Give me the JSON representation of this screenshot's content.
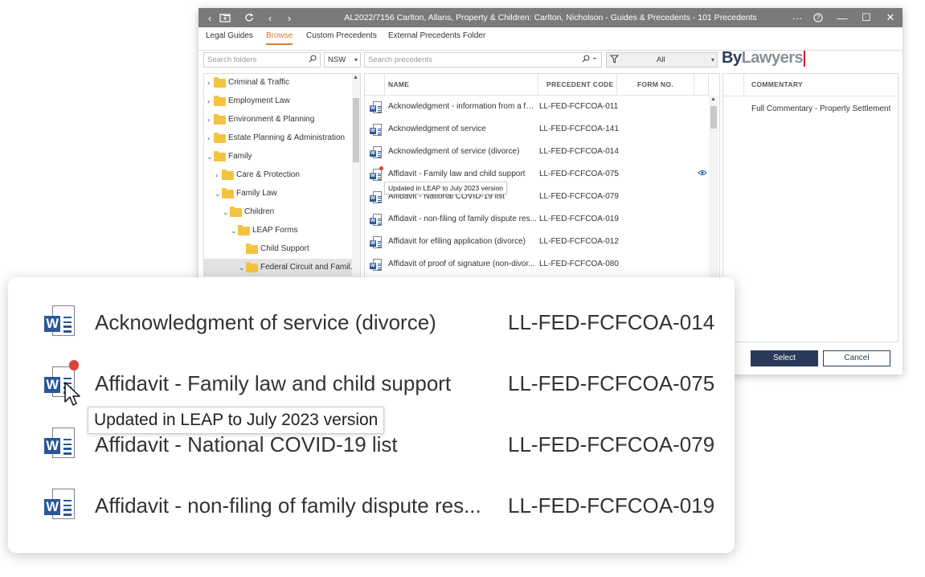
{
  "window": {
    "title": "AL2022/7156 Carlton, Allans, Property & Children: Carlton, Nicholson - Guides & Precedents - 101 Precedents",
    "buttons": {
      "more": "···",
      "help": "?",
      "minimize": "—",
      "maximize": "☐",
      "close": "✕"
    }
  },
  "tabs": [
    {
      "label": "Legal Guides",
      "active": false
    },
    {
      "label": "Browse",
      "active": true
    },
    {
      "label": "Custom Precedents",
      "active": false
    },
    {
      "label": "External Precedents Folder",
      "active": false
    }
  ],
  "search": {
    "folders_placeholder": "Search folders",
    "state_value": "NSW",
    "precedents_placeholder": "Search precedents",
    "filter_value": "All"
  },
  "brand": {
    "part1": "By",
    "part2": "Lawyers"
  },
  "tree": {
    "items": [
      {
        "label": "Criminal & Traffic",
        "chevron": "›"
      },
      {
        "label": "Employment Law",
        "chevron": "›"
      },
      {
        "label": "Environment & Planning",
        "chevron": "›"
      },
      {
        "label": "Estate Planning & Administration",
        "chevron": "›"
      },
      {
        "label": "Family",
        "chevron": "⌄"
      },
      {
        "label": "Care & Protection",
        "chevron": "›"
      },
      {
        "label": "Family Law",
        "chevron": "⌄"
      },
      {
        "label": "Children",
        "chevron": "⌄"
      },
      {
        "label": "LEAP Forms",
        "chevron": "⌄"
      },
      {
        "label": "Child Support",
        "chevron": ""
      },
      {
        "label": "Federal Circuit and Famil...",
        "chevron": "⌄"
      }
    ]
  },
  "grid": {
    "headers": {
      "name": "NAME",
      "code": "PRECEDENT CODE",
      "form": "FORM NO."
    },
    "rows": [
      {
        "name": "Acknowledgment - information from a fa...",
        "code": "LL-FED-FCFCOA-011"
      },
      {
        "name": "Acknowledgment of service",
        "code": "LL-FED-FCFCOA-141"
      },
      {
        "name": "Acknowledgment of service (divorce)",
        "code": "LL-FED-FCFCOA-014"
      },
      {
        "name": "Affidavit - Family law and child support",
        "code": "LL-FED-FCFCOA-075"
      },
      {
        "name": "Affidavit - National COVID-19 list",
        "code": "LL-FED-FCFCOA-079"
      },
      {
        "name": "Affidavit - non-filing of family dispute res...",
        "code": "LL-FED-FCFCOA-019"
      },
      {
        "name": "Affidavit for efiling application (divorce)",
        "code": "LL-FED-FCFCOA-012"
      },
      {
        "name": "Affidavit of proof of signature (non-divor...",
        "code": "LL-FED-FCFCOA-080"
      }
    ],
    "tooltip": "Updated in LEAP to July 2023 version"
  },
  "commentary": {
    "header": "COMMENTARY",
    "item": "Full Commentary - Property Settlement"
  },
  "actions": {
    "select": "Select",
    "cancel": "Cancel"
  },
  "icons": {
    "word": "W"
  },
  "zoom": {
    "rows": [
      {
        "name": "Acknowledgment of service (divorce)",
        "code": "LL-FED-FCFCOA-014"
      },
      {
        "name": "Affidavit - Family law and child support",
        "code": "LL-FED-FCFCOA-075"
      },
      {
        "name": "Affidavit - National COVID-19 list",
        "code": "LL-FED-FCFCOA-079"
      },
      {
        "name": "Affidavit - non-filing of family dispute res...",
        "code": "LL-FED-FCFCOA-019"
      }
    ],
    "tooltip": "Updated in LEAP to July 2023 version"
  }
}
